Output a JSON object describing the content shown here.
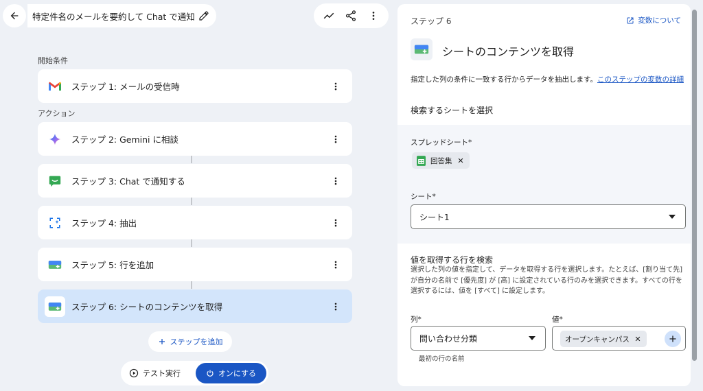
{
  "header": {
    "title": "特定件名のメールを要約して Chat で通知"
  },
  "flow": {
    "trigger_section": "開始条件",
    "action_section": "アクション",
    "steps": [
      {
        "label": "ステップ 1: メールの受信時"
      },
      {
        "label": "ステップ 2: Gemini に相談"
      },
      {
        "label": "ステップ 3: Chat で通知する"
      },
      {
        "label": "ステップ 4: 抽出"
      },
      {
        "label": "ステップ 5: 行を追加"
      },
      {
        "label": "ステップ 6: シートのコンテンツを取得"
      }
    ],
    "add_step_label": "ステップを追加",
    "test_run_label": "テスト実行",
    "turn_on_label": "オンにする"
  },
  "panel": {
    "step_number": "ステップ 6",
    "vars_link": "変数について",
    "title": "シートのコンテンツを取得",
    "description": "指定した列の条件に一致する行からデータを抽出します。",
    "description_link": "このステップの変数の詳細",
    "select_sheet_heading": "検索するシートを選択",
    "spreadsheet_label": "スプレッドシート*",
    "spreadsheet_chip": "回答集",
    "sheet_label": "シート*",
    "sheet_value": "シート1",
    "row_search_heading": "値を取得する行を検索",
    "row_search_desc": "選択した列の値を指定して、データを取得する行を選択します。たとえば、[割り当て先] が自分の名前で [優先度] が [高] に設定されている行のみを選択できます。すべての行を選択するには、値を [すべて] に設定します。",
    "column_label": "列*",
    "column_value": "問い合わせ分類",
    "column_helper": "最初の行の名前",
    "value_label": "値*",
    "value_chip": "オープンキャンパス"
  },
  "colors": {
    "accent": "#1a56c4",
    "active_step": "#d3e5fb",
    "background": "#eef1f6"
  }
}
